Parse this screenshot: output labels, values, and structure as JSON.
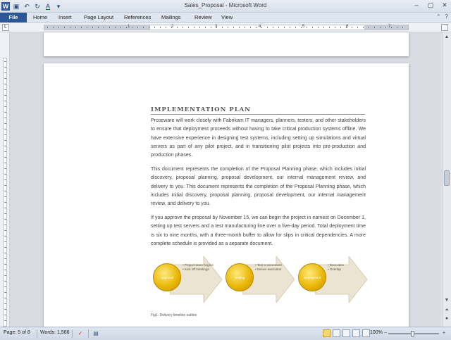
{
  "window": {
    "title": "Sales_Proposal - Microsoft Word"
  },
  "quick_access": [
    "word-icon",
    "save-icon",
    "undo-icon",
    "redo-icon",
    "font-color-icon",
    "customize-icon"
  ],
  "tabs": {
    "file": "File",
    "items": [
      "Home",
      "Insert",
      "Page Layout",
      "References",
      "Mailings",
      "Review",
      "View"
    ]
  },
  "ruler": {
    "numbers": [
      "1",
      "2",
      "3",
      "4",
      "5",
      "6",
      "7"
    ]
  },
  "document": {
    "heading": "IMPLEMENTATION PLAN",
    "paragraphs": [
      "Proseware will work closely with Fabrikam IT managers, planners, testers, and other stakeholders to ensure that deployment proceeds without having to take critical production systems offline. We have extensive experience in designing test systems, including setting up simulations and virtual servers as part of any pilot project, and in transitioning pilot projects into pre-production and production phases.",
      "This document represents the completion of the Proposal Planning phase, which includes initial discovery, proposal planning, proposal development, our internal management review, and delivery to you. This document represents the completion of the Proposal Planning phase, which includes initial discovery, proposal planning, proposal development, our internal management review, and delivery to you.",
      "If you approve the proposal by November 15, we can begin the project in earnest on December 1, setting up test servers and a test manufacturing line over a five-day period. Total deployment time is six to nine months, with a three-month buffer to allow for slips in critical dependencies. A more complete schedule is provided as a separate document."
    ],
    "smartart": [
      {
        "label": "Approval",
        "bullets": [
          "Project team begins",
          "Kick off meetings"
        ]
      },
      {
        "label": "Testing",
        "bullets": [
          "Test environment",
          "Server execution"
        ]
      },
      {
        "label": "Deployment",
        "bullets": [
          "Execution",
          "Overlap"
        ]
      }
    ],
    "caption": "Fig1. Delivery timeline outline"
  },
  "status": {
    "page": "Page: 5 of 8",
    "words": "Words: 1,566",
    "zoom": "100%"
  },
  "colors": {
    "file_tab": "#2b5797",
    "accent_gold": "#e8b400"
  }
}
